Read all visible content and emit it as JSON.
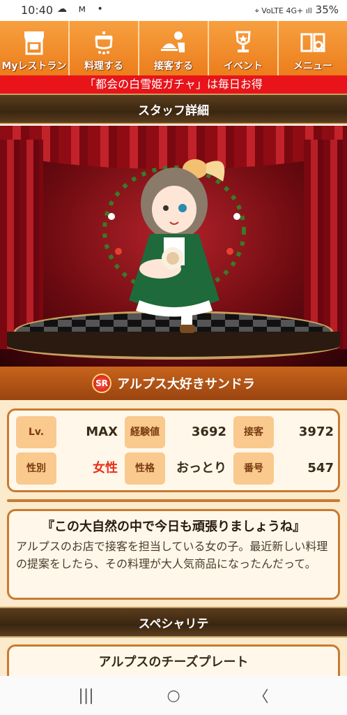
{
  "status_bar": {
    "time": "10:40",
    "left_icons": "☁ ᴍ •",
    "battery": "35%",
    "right_icons": "⌖ VoLTE 4G+ ıll"
  },
  "nav": {
    "items": [
      {
        "label": "Myレストラン",
        "icon": "shop-icon"
      },
      {
        "label": "料理する",
        "icon": "pot-icon"
      },
      {
        "label": "接客する",
        "icon": "waiter-icon"
      },
      {
        "label": "イベント",
        "icon": "trophy-icon"
      },
      {
        "label": "メニュー",
        "icon": "book-search-icon"
      }
    ]
  },
  "banner": {
    "text": "「都会の白雪姫ガチャ」は毎日お得"
  },
  "staff_header": {
    "title": "スタッフ詳細"
  },
  "staff": {
    "rarity": "SR",
    "name": "アルプス大好きサンドラ"
  },
  "stats": {
    "lv_label": "Lv.",
    "lv_value": "MAX",
    "exp_label": "経験値",
    "exp_value": "3692",
    "service_label": "接客",
    "service_value": "3972",
    "gender_label": "性別",
    "gender_value": "女性",
    "personality_label": "性格",
    "personality_value": "おっとり",
    "number_label": "番号",
    "number_value": "547"
  },
  "quote": {
    "title": "『この大自然の中で今日も頑張りましょうね』",
    "body": "アルプスのお店で接客を担当している女の子。最近新しい料理の提案をしたら、その料理が大人気商品になったんだって。"
  },
  "specialty_header": {
    "title": "スペシャリテ"
  },
  "specialty": {
    "dish": "アルプスのチーズプレート"
  },
  "android_nav": {
    "recent": "|||",
    "home": "○",
    "back": "〈"
  }
}
